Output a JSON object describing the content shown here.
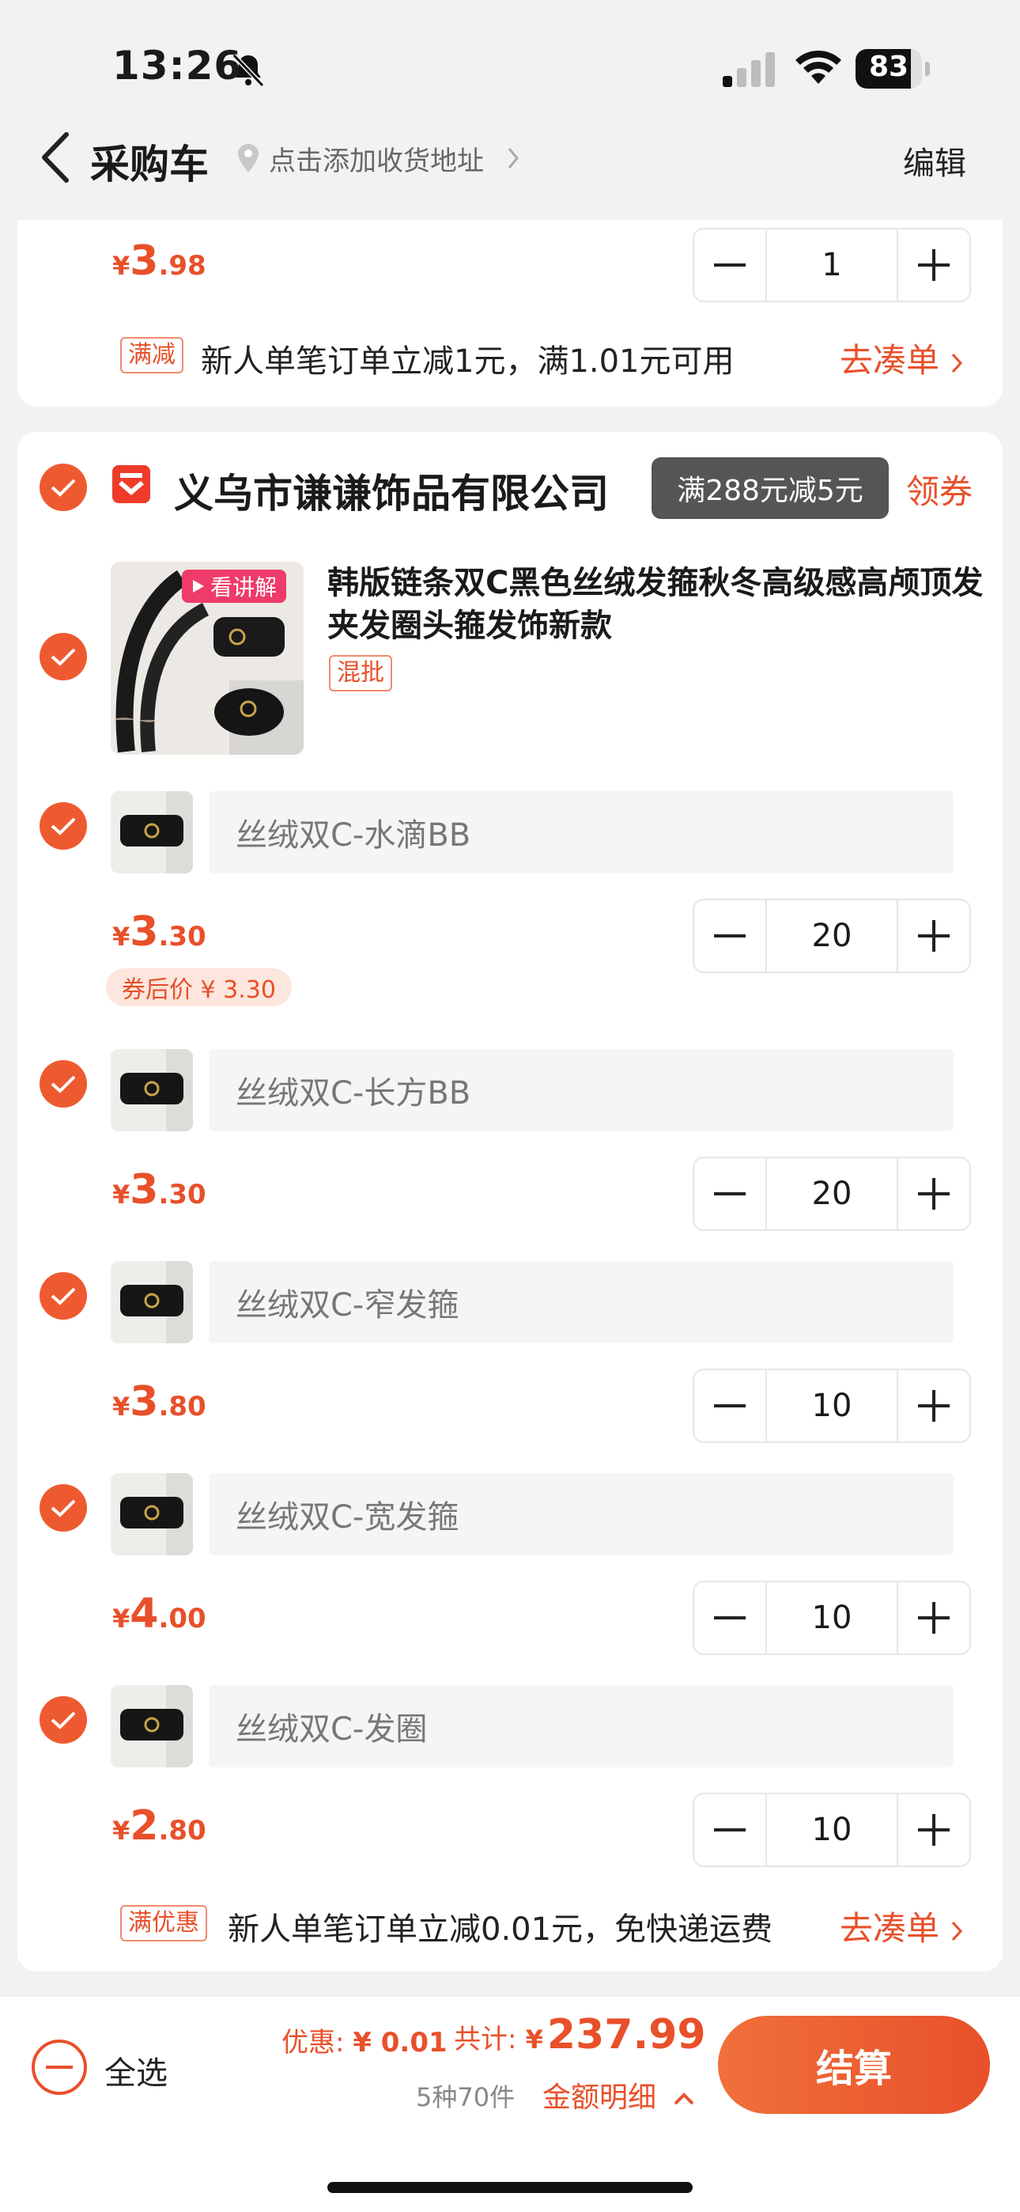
{
  "status_bar": {
    "time": "13:26",
    "battery": "83",
    "battery_level": 0.83
  },
  "nav": {
    "title": "采购车",
    "address_hint": "点击添加收货地址",
    "edit_label": "编辑"
  },
  "prev_item": {
    "currency": "¥",
    "price_int": "3",
    "price_dec": ".98",
    "qty": "1"
  },
  "prev_promo": {
    "tag": "满减",
    "text": "新人单笔订单立减1元，满1.01元可用",
    "link": "去凑单"
  },
  "store": {
    "name": "义乌市谦谦饰品有限公司",
    "tooltip": "满288元减5元",
    "coupon_label": "领券",
    "product": {
      "title": "韩版链条双C黑色丝绒发箍秋冬高级感高颅顶发夹发圈头箍发饰新款",
      "video_label": "看讲解",
      "tag": "混批"
    },
    "skus": [
      {
        "name": "丝绒双C-水滴BB",
        "currency": "¥",
        "price_int": "3",
        "price_dec": ".30",
        "qty": "20",
        "after_coupon": "券后价 ¥ 3.30"
      },
      {
        "name": "丝绒双C-长方BB",
        "currency": "¥",
        "price_int": "3",
        "price_dec": ".30",
        "qty": "20"
      },
      {
        "name": "丝绒双C-窄发箍",
        "currency": "¥",
        "price_int": "3",
        "price_dec": ".80",
        "qty": "10"
      },
      {
        "name": "丝绒双C-宽发箍",
        "currency": "¥",
        "price_int": "4",
        "price_dec": ".00",
        "qty": "10"
      },
      {
        "name": "丝绒双C-发圈",
        "currency": "¥",
        "price_int": "2",
        "price_dec": ".80",
        "qty": "10"
      }
    ],
    "promo": {
      "tag": "满优惠",
      "text": "新人单笔订单立减0.01元，免快递运费",
      "link": "去凑单"
    }
  },
  "bottom": {
    "select_all": "全选",
    "discount_label": "优惠:",
    "discount_value": "¥ 0.01",
    "total_label": "共计:",
    "total_currency": "¥",
    "total_value": "237.99",
    "count": "5种70件",
    "detail_label": "金额明细",
    "checkout_label": "结算"
  },
  "colors": {
    "accent": "#e8502a",
    "checkout_gradient": [
      "#f0703a",
      "#e8502a"
    ]
  }
}
